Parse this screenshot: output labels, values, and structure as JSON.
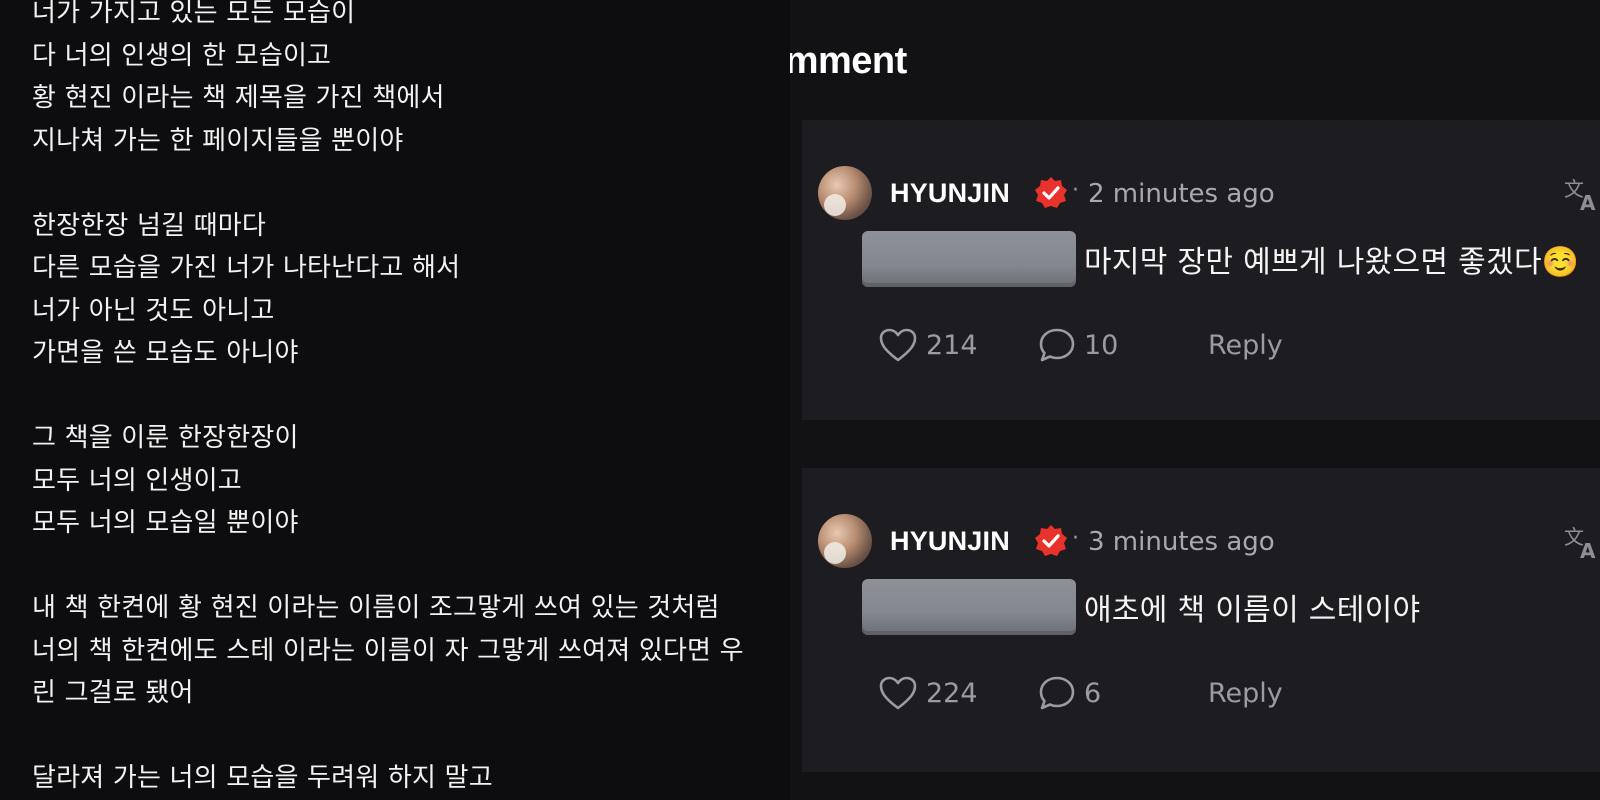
{
  "letter": {
    "lines": [
      "너가 가지고 있는 모든 모습이",
      "다 너의 인생의 한 모습이고",
      "황 현진 이라는 책 제목을 가진 책에서",
      "지나쳐 가는 한 페이지들을 뿐이야",
      "",
      "한장한장 넘길 때마다",
      "다른 모습을 가진 너가 나타난다고 해서",
      "너가 아닌 것도 아니고",
      "가면을 쓴 모습도 아니야",
      "",
      "그 책을 이룬 한장한장이",
      "모두 너의 인생이고",
      "모두 너의 모습일 뿐이야",
      "",
      "내 책 한켠에 황 현진 이라는 이름이 조그맣게 쓰여 있는 것처럼",
      "너의 책 한켠에도 스테 이라는 이름이 자 그맣게 쓰여져 있다면 우",
      "린 그걸로 됐어",
      "",
      "달라져 가는 너의 모습을 두려워 하지 말고"
    ]
  },
  "comments_panel": {
    "title": "omment",
    "comments": [
      {
        "username": "HYUNJIN",
        "separator": "·",
        "timestamp": "2 minutes ago",
        "text": "마지막 장만 예쁘게 나왔으면 좋겠다☺️",
        "likes": "214",
        "replies": "10",
        "reply_label": "Reply"
      },
      {
        "username": "HYUNJIN",
        "separator": "·",
        "timestamp": "3 minutes ago",
        "text": "애초에 책 이름이 스테이야",
        "likes": "224",
        "replies": "6",
        "reply_label": "Reply"
      }
    ]
  },
  "colors": {
    "letter_bg": "#0d0d0f",
    "comment_pane_bg": "#121214",
    "card_bg": "#1d1d21",
    "verified_badge": "#e8322b",
    "muted_text": "#9b9ba1"
  },
  "icons": [
    "verified-badge-icon",
    "translate-icon",
    "heart-icon",
    "comment-bubble-icon"
  ]
}
